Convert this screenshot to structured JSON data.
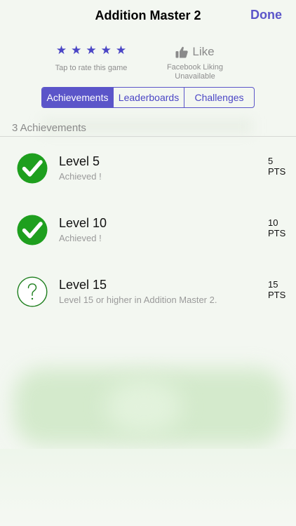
{
  "nav": {
    "title": "Addition Master 2",
    "done_label": "Done"
  },
  "rating": {
    "stars": [
      "★",
      "★",
      "★",
      "★",
      "★"
    ],
    "label": "Tap to rate this game"
  },
  "like": {
    "label": "Like",
    "sublabel_line1": "Facebook Liking",
    "sublabel_line2": "Unavailable"
  },
  "tabs": [
    {
      "label": "Achievements",
      "selected": true
    },
    {
      "label": "Leaderboards",
      "selected": false
    },
    {
      "label": "Challenges",
      "selected": false
    }
  ],
  "section": {
    "header": "3 Achievements"
  },
  "achievements": [
    {
      "title": "Level 5",
      "subtitle": "Achieved !",
      "points": "5",
      "unit": "PTS",
      "status": "achieved",
      "icon": "checkmark-icon"
    },
    {
      "title": "Level 10",
      "subtitle": "Achieved !",
      "points": "10",
      "unit": "PTS",
      "status": "achieved",
      "icon": "checkmark-icon"
    },
    {
      "title": "Level 15",
      "subtitle": "Level 15 or higher in Addition Master 2.",
      "points": "15",
      "unit": "PTS",
      "status": "locked",
      "icon": "question-icon"
    }
  ],
  "colors": {
    "accent": "#5b55c9",
    "achieved_green": "#1e9f1e"
  }
}
